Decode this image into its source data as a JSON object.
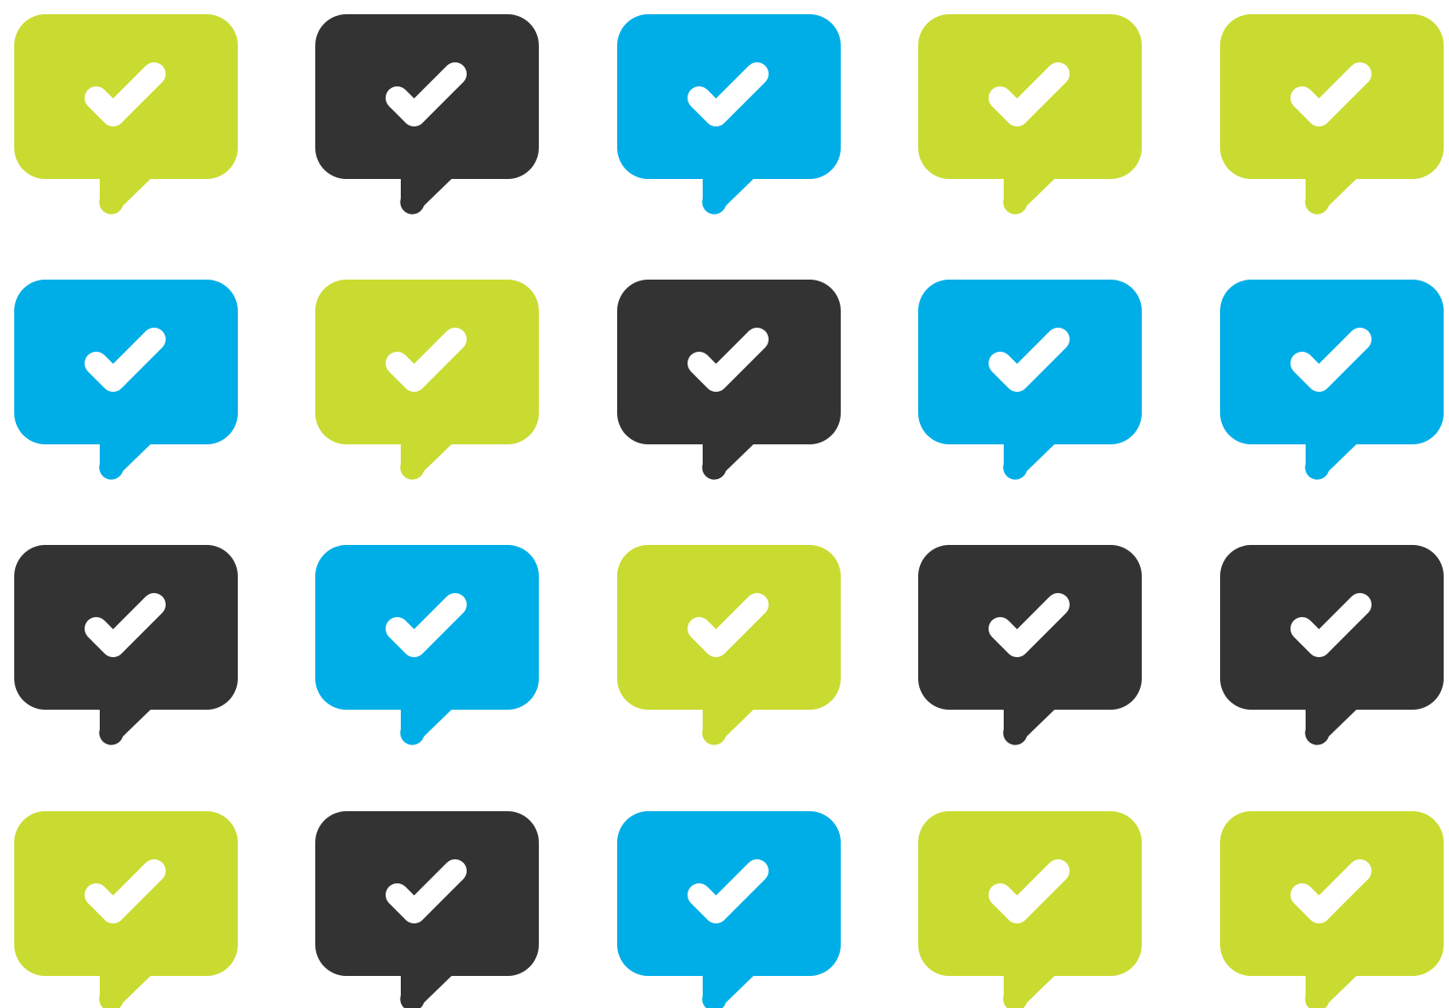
{
  "palette": {
    "lime": "#C9DB31",
    "charcoal": "#333333",
    "sky": "#00AEE7",
    "check": "#FFFFFF"
  },
  "icon": {
    "name": "speech-bubble-check-icon",
    "check_name": "checkmark-icon"
  },
  "rows": [
    [
      "lime",
      "charcoal",
      "sky",
      "lime",
      "lime"
    ],
    [
      "sky",
      "lime",
      "charcoal",
      "sky",
      "sky"
    ],
    [
      "charcoal",
      "sky",
      "lime",
      "charcoal",
      "charcoal"
    ],
    [
      "lime",
      "charcoal",
      "sky",
      "lime",
      "lime"
    ]
  ]
}
